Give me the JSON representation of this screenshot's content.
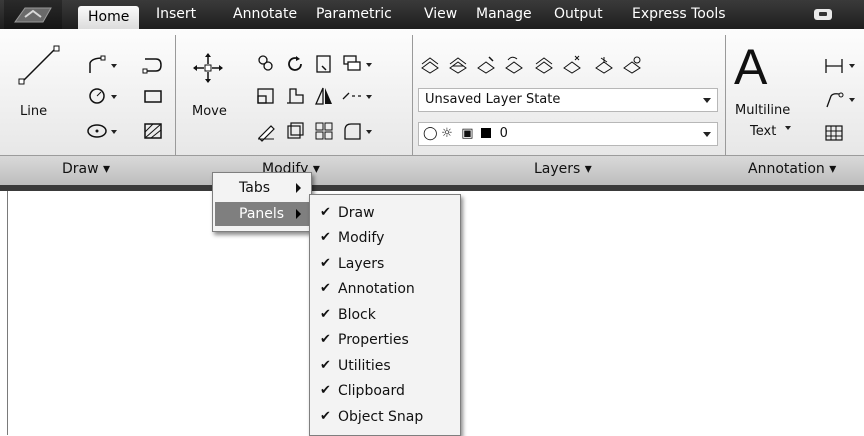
{
  "tabs": [
    "Home",
    "Insert",
    "Annotate",
    "Parametric",
    "View",
    "Manage",
    "Output",
    "Express Tools"
  ],
  "active_tab": "Home",
  "ribbon": {
    "draw": {
      "title": "Draw",
      "line_label": "Line"
    },
    "modify": {
      "title": "Modify",
      "move_label": "Move"
    },
    "layers": {
      "title": "Layers",
      "layer_state": "Unsaved Layer State",
      "current_layer": "0"
    },
    "annotation": {
      "title": "Annotation",
      "multiline_label_1": "Multiline",
      "multiline_label_2": "Text",
      "big_letter": "A"
    }
  },
  "context_menu": {
    "items": [
      {
        "label": "Tabs",
        "submenu": true
      },
      {
        "label": "Panels",
        "submenu": true
      }
    ]
  },
  "panels_submenu": {
    "items": [
      {
        "label": "Draw",
        "checked": true
      },
      {
        "label": "Modify",
        "checked": true
      },
      {
        "label": "Layers",
        "checked": true
      },
      {
        "label": "Annotation",
        "checked": true
      },
      {
        "label": "Block",
        "checked": true
      },
      {
        "label": "Properties",
        "checked": true
      },
      {
        "label": "Utilities",
        "checked": true
      },
      {
        "label": "Clipboard",
        "checked": true
      },
      {
        "label": "Object Snap",
        "checked": true
      }
    ]
  },
  "colors": {
    "tabbar": "#2a2a2a",
    "ribbon_bg": "#efefef",
    "menu_highlight": "#7f7f7f"
  }
}
